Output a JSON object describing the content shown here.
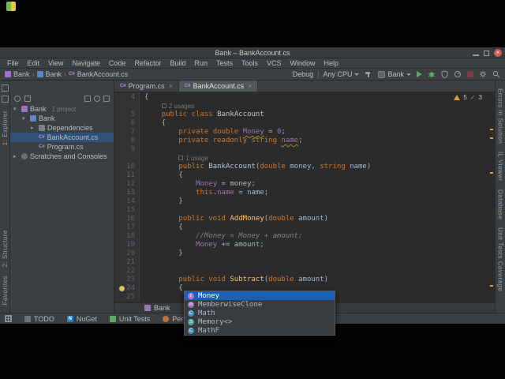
{
  "window": {
    "title": "Bank – BankAccount.cs",
    "menu": [
      "File",
      "Edit",
      "View",
      "Navigate",
      "Code",
      "Refactor",
      "Build",
      "Run",
      "Tests",
      "Tools",
      "VCS",
      "Window",
      "Help"
    ],
    "navbar": {
      "crumbs": [
        "Bank",
        "Bank",
        "BankAccount.cs"
      ]
    },
    "run": {
      "solution_config": "Debug",
      "platform": "Any CPU",
      "run_config": "Bank"
    },
    "left_stripe": {
      "labels": [
        "1: Explorer",
        "2: Structure",
        "Favorites"
      ]
    },
    "right_stripe": {
      "labels": [
        "Errors in Solution",
        "IL Viewer",
        "Database",
        "Unit Tests Coverage"
      ]
    },
    "project": {
      "items": [
        {
          "label": "Bank",
          "suffix": "1 project",
          "depth": 0,
          "icon": "solution",
          "chevron": "down"
        },
        {
          "label": "Bank",
          "depth": 1,
          "icon": "project",
          "chevron": "down"
        },
        {
          "label": "Dependencies",
          "depth": 2,
          "icon": "deps",
          "chevron": "right"
        },
        {
          "label": "BankAccount.cs",
          "depth": 2,
          "icon": "cs",
          "chevron": "none",
          "selected": true
        },
        {
          "label": "Program.cs",
          "depth": 2,
          "icon": "cs",
          "chevron": "none"
        },
        {
          "label": "Scratches and Consoles",
          "depth": 0,
          "icon": "scratch",
          "chevron": "right"
        }
      ]
    },
    "tabs": [
      {
        "label": "Program.cs",
        "active": false
      },
      {
        "label": "BankAccount.cs",
        "active": true
      }
    ],
    "editor": {
      "inspection": {
        "warnings": "5",
        "weak_warnings": "3"
      },
      "breadcrumb": {
        "label": "Bank"
      },
      "rows": [
        {
          "n": "4",
          "seg": [
            [
              "{",
              ""
            ]
          ]
        },
        {
          "n": "",
          "hint": "2 usages",
          "pad": "    "
        },
        {
          "n": "5",
          "seg": [
            [
              "    ",
              ""
            ],
            [
              "public class ",
              "k"
            ],
            [
              "BankAccount",
              "c"
            ]
          ]
        },
        {
          "n": "6",
          "seg": [
            [
              "    {",
              ""
            ]
          ]
        },
        {
          "n": "7",
          "seg": [
            [
              "        ",
              ""
            ],
            [
              "private double ",
              "k"
            ],
            [
              "Money",
              "f w"
            ],
            [
              " = ",
              ""
            ],
            [
              "0",
              "nu"
            ],
            [
              ";",
              ""
            ]
          ]
        },
        {
          "n": "8",
          "seg": [
            [
              "        ",
              ""
            ],
            [
              "private readonly string ",
              "k"
            ],
            [
              "name",
              "f w"
            ],
            [
              ";",
              ""
            ]
          ]
        },
        {
          "n": "9",
          "seg": []
        },
        {
          "n": "",
          "hint": "1 usage",
          "pad": "        "
        },
        {
          "n": "10",
          "seg": [
            [
              "        ",
              ""
            ],
            [
              "public ",
              "k"
            ],
            [
              "BankAccount",
              "c"
            ],
            [
              "(",
              ""
            ],
            [
              "double ",
              "k"
            ],
            [
              "money",
              ""
            ],
            [
              ", ",
              ""
            ],
            [
              "string ",
              "k"
            ],
            [
              "name",
              ""
            ],
            [
              ")",
              ""
            ]
          ]
        },
        {
          "n": "11",
          "seg": [
            [
              "        {",
              ""
            ]
          ]
        },
        {
          "n": "12",
          "seg": [
            [
              "            ",
              ""
            ],
            [
              "Money",
              "f"
            ],
            [
              " = money;",
              ""
            ]
          ]
        },
        {
          "n": "13",
          "seg": [
            [
              "            ",
              ""
            ],
            [
              "this",
              "k"
            ],
            [
              ".",
              ""
            ],
            [
              "name",
              "f"
            ],
            [
              " = name;",
              ""
            ]
          ]
        },
        {
          "n": "14",
          "seg": [
            [
              "        }",
              ""
            ]
          ]
        },
        {
          "n": "15",
          "seg": []
        },
        {
          "n": "16",
          "seg": [
            [
              "        ",
              ""
            ],
            [
              "public void ",
              "k"
            ],
            [
              "AddMoney",
              "m"
            ],
            [
              "(",
              ""
            ],
            [
              "double ",
              "k"
            ],
            [
              "amount",
              ""
            ],
            [
              ")",
              ""
            ]
          ]
        },
        {
          "n": "17",
          "seg": [
            [
              "        {",
              ""
            ]
          ]
        },
        {
          "n": "18",
          "seg": [
            [
              "            ",
              ""
            ],
            [
              "//Money = Money + amount;",
              "cm"
            ]
          ]
        },
        {
          "n": "19",
          "seg": [
            [
              "            ",
              ""
            ],
            [
              "Money",
              "f"
            ],
            [
              " += amount;",
              ""
            ]
          ]
        },
        {
          "n": "20",
          "seg": [
            [
              "        }",
              ""
            ]
          ]
        },
        {
          "n": "21",
          "seg": []
        },
        {
          "n": "22",
          "seg": []
        },
        {
          "n": "23",
          "seg": [
            [
              "        ",
              ""
            ],
            [
              "public void ",
              "k"
            ],
            [
              "Subtract",
              "m"
            ],
            [
              "(",
              ""
            ],
            [
              "double ",
              "k"
            ],
            [
              "amount",
              ""
            ],
            [
              ")",
              ""
            ]
          ]
        },
        {
          "n": "24",
          "seg": [
            [
              "        {",
              ""
            ]
          ],
          "bulb": true
        },
        {
          "n": "25",
          "seg": [
            [
              "            Mo",
              ""
            ]
          ],
          "caret": true
        }
      ]
    },
    "bottombar": {
      "items": [
        "TODO",
        "NuGet",
        "Unit Tests",
        "Performance Profiler"
      ]
    }
  },
  "completion": {
    "items": [
      {
        "label": "Money",
        "kind": "field",
        "selected": true
      },
      {
        "label": "MemberwiseClone",
        "kind": "method"
      },
      {
        "label": "Math",
        "kind": "class"
      },
      {
        "label": "Memory<>",
        "kind": "struct"
      },
      {
        "label": "MathF",
        "kind": "class"
      }
    ]
  },
  "colors": {
    "chrome": "#3c3f41",
    "editor_bg": "#2b2b2b",
    "selection": "#1a61b6",
    "tree_selection": "#2d5177",
    "keyword": "#cc7832",
    "field": "#9876aa",
    "method": "#ffc66d",
    "number": "#6897bb",
    "comment": "#808080",
    "warning": "#d9a343",
    "run_green": "#5baa63"
  }
}
